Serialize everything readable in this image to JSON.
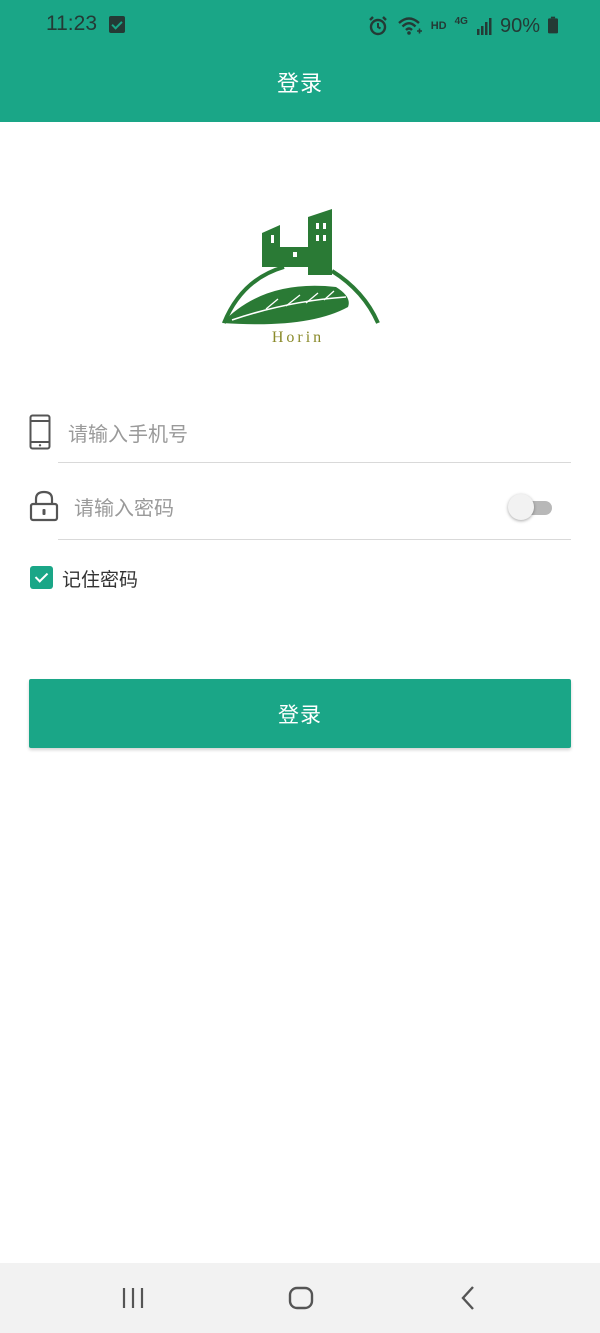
{
  "status_bar": {
    "time": "11:23",
    "network": "HD",
    "signal_label": "4G",
    "battery": "90%"
  },
  "header": {
    "title": "登录"
  },
  "logo": {
    "brand": "Horin"
  },
  "form": {
    "phone_placeholder": "请输入手机号",
    "password_placeholder": "请输入密码",
    "show_password_toggle": false,
    "remember_checked": true,
    "remember_label": "记住密码",
    "login_label": "登录"
  },
  "colors": {
    "primary": "#1aa687",
    "logo_green": "#2a7a35",
    "logo_text": "#8a8a2a"
  },
  "icons": [
    "check-notification-icon",
    "alarm-icon",
    "wifi-icon",
    "signal-icon",
    "battery-icon",
    "phone-icon",
    "lock-icon",
    "checkbox-check-icon",
    "recent-apps-icon",
    "home-icon",
    "back-icon"
  ]
}
